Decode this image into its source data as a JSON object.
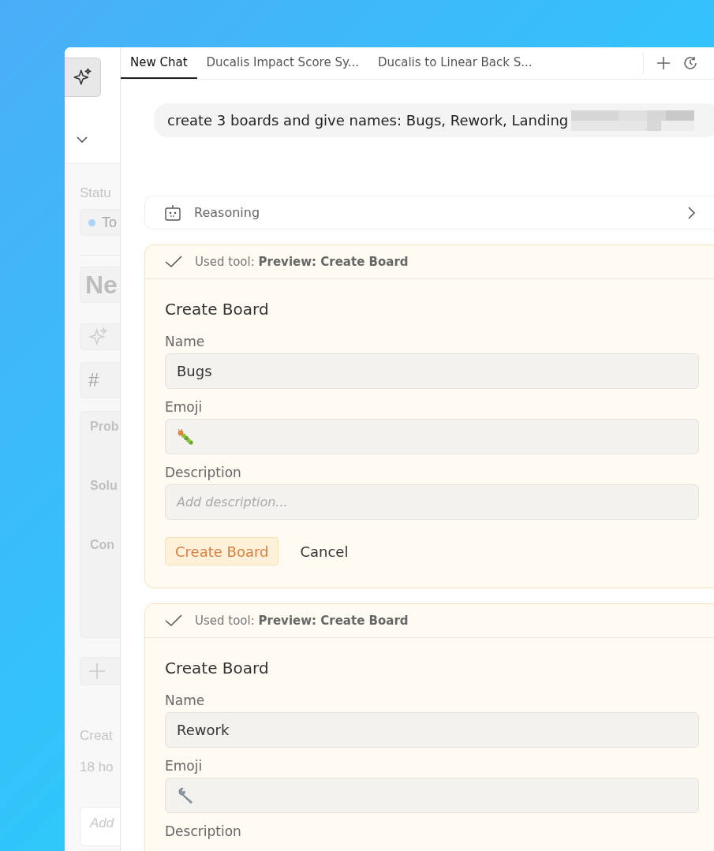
{
  "sidebar": {
    "status_label": "Statu",
    "status_chip": "To",
    "title": "Ne",
    "number_chip": "#",
    "sections": [
      "Prob",
      "Solu",
      "Con"
    ],
    "created_label": "Creat",
    "created_value": "18 ho",
    "comment_placeholder": "Add"
  },
  "tabs": [
    {
      "label": "New Chat",
      "selected": true
    },
    {
      "label": "Ducalis Impact Score Sy...",
      "selected": false
    },
    {
      "label": "Ducalis to Linear Back S...",
      "selected": false
    }
  ],
  "message": {
    "text": "create 3 boards and give names: Bugs, Rework, Landing",
    "redacted": true
  },
  "reasoning": {
    "label": "Reasoning",
    "expanded": false
  },
  "tool_calls": [
    {
      "header": "Used tool: **Preview: Create Board**",
      "done": true,
      "form": {
        "title": "Create Board",
        "fields": [
          {
            "label": "Name",
            "value": "Bugs"
          },
          {
            "label": "Emoji",
            "kind": "emoji"
          },
          {
            "label": "Description",
            "placeholder": "Add description..."
          }
        ],
        "buttons": [
          {
            "label": "Create Board",
            "kind": "primary"
          },
          {
            "label": "Cancel",
            "kind": "plain"
          }
        ]
      }
    },
    {
      "header": "Used tool: **Preview: Create Board**",
      "done": true,
      "form": {
        "title": "Create Board",
        "fields": [
          {
            "label": "Name",
            "value": "Rework"
          },
          {
            "label": "Emoji",
            "kind": "emoji"
          },
          {
            "label": "Description"
          }
        ]
      }
    }
  ]
}
